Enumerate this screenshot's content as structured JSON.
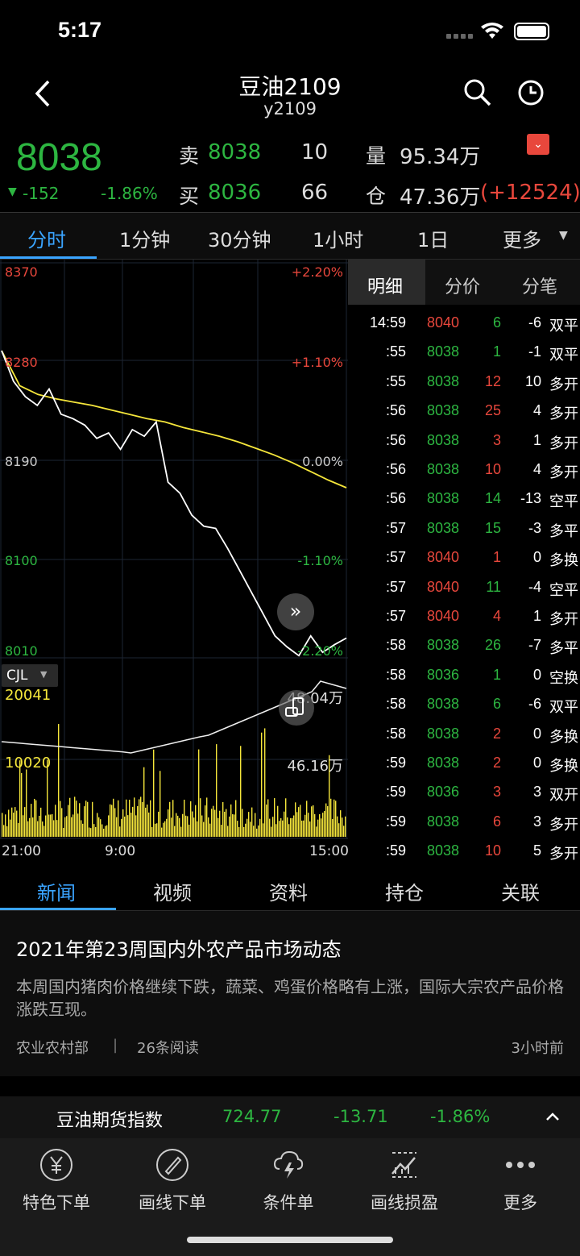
{
  "status_bar": {
    "time": "5:17"
  },
  "header": {
    "title": "豆油2109",
    "subtitle": "y2109"
  },
  "quote": {
    "price": "8038",
    "change": "-152",
    "change_pct": "-1.86%",
    "sell_label": "卖",
    "sell_price": "8038",
    "sell_qty": "10",
    "buy_label": "买",
    "buy_price": "8036",
    "buy_qty": "66",
    "volume_label": "量",
    "volume": "95.34万",
    "oi_label": "仓",
    "oi": "47.36万",
    "oi_change": "(+12524)"
  },
  "period_tabs": [
    "分时",
    "1分钟",
    "30分钟",
    "1小时",
    "1日",
    "更多"
  ],
  "chart": {
    "y_left": [
      "8370",
      "8280",
      "8190",
      "8100",
      "8010"
    ],
    "y_right": [
      "+2.20%",
      "+1.10%",
      "0.00%",
      "-1.10%",
      "-2.20%"
    ],
    "indicator": "CJL",
    "vol_max": "20041",
    "vol_mid": "10020",
    "oi_top": "48.04万",
    "oi_mid": "46.16万",
    "x_labels": [
      "21:00",
      "9:00",
      "15:00"
    ]
  },
  "chart_data": {
    "type": "line",
    "series": [
      {
        "name": "price",
        "values": [
          8290,
          8262,
          8248,
          8240,
          8255,
          8232,
          8228,
          8222,
          8210,
          8215,
          8200,
          8218,
          8212,
          8225,
          8170,
          8160,
          8140,
          8130,
          8128,
          8110,
          8090,
          8070,
          8050,
          8030,
          8020,
          8012,
          8030,
          8015,
          8022,
          8028
        ]
      },
      {
        "name": "avg",
        "values": [
          8290,
          8258,
          8250,
          8246,
          8243,
          8240,
          8236,
          8232,
          8228,
          8225,
          8220,
          8216,
          8212,
          8207,
          8201,
          8195,
          8188,
          8180,
          8172,
          8165
        ]
      }
    ],
    "ylim": [
      8010,
      8370
    ]
  },
  "detail": {
    "tabs": [
      "明细",
      "分价",
      "分笔"
    ],
    "rows": [
      [
        "14:59",
        "8040",
        "6",
        "-6",
        "双平"
      ],
      [
        ":55",
        "8038",
        "1",
        "-1",
        "双平"
      ],
      [
        ":55",
        "8038",
        "12",
        "10",
        "多开"
      ],
      [
        ":56",
        "8038",
        "25",
        "4",
        "多开"
      ],
      [
        ":56",
        "8038",
        "3",
        "1",
        "多开"
      ],
      [
        ":56",
        "8038",
        "10",
        "4",
        "多开"
      ],
      [
        ":56",
        "8038",
        "14",
        "-13",
        "空平"
      ],
      [
        ":57",
        "8038",
        "15",
        "-3",
        "多平"
      ],
      [
        ":57",
        "8040",
        "1",
        "0",
        "多换"
      ],
      [
        ":57",
        "8040",
        "11",
        "-4",
        "空平"
      ],
      [
        ":57",
        "8040",
        "4",
        "1",
        "多开"
      ],
      [
        ":58",
        "8038",
        "26",
        "-7",
        "多平"
      ],
      [
        ":58",
        "8036",
        "1",
        "0",
        "空换"
      ],
      [
        ":58",
        "8038",
        "6",
        "-6",
        "双平"
      ],
      [
        ":58",
        "8038",
        "2",
        "0",
        "多换"
      ],
      [
        ":59",
        "8038",
        "2",
        "0",
        "多换"
      ],
      [
        ":59",
        "8036",
        "3",
        "3",
        "双开"
      ],
      [
        ":59",
        "8038",
        "6",
        "3",
        "多开"
      ],
      [
        ":59",
        "8038",
        "10",
        "5",
        "多开"
      ]
    ]
  },
  "news_tabs": [
    "新闻",
    "视频",
    "资料",
    "持仓",
    "关联"
  ],
  "news": {
    "title": "2021年第23周国内外农产品市场动态",
    "summary": "本周国内猪肉价格继续下跌，蔬菜、鸡蛋价格略有上涨，国际大宗农产品价格涨跌互现。",
    "source": "农业农村部",
    "sep": "|",
    "reads": "26条阅读",
    "time": "3小时前"
  },
  "index_bar": {
    "name": "豆油期货指数",
    "value": "724.77",
    "change": "-13.71",
    "pct": "-1.86%"
  },
  "bottom_nav": [
    "特色下单",
    "画线下单",
    "条件单",
    "画线损盈",
    "更多"
  ],
  "colors": {
    "up": "#e8473c",
    "down": "#2db641",
    "accent": "#3aa4ff",
    "avg": "#f5e63b"
  }
}
